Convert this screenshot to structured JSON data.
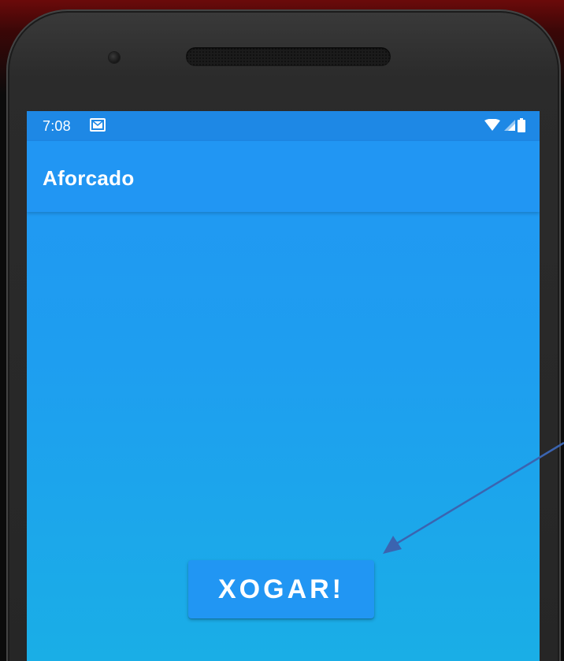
{
  "status_bar": {
    "time": "7:08",
    "icons": [
      "gmail-icon",
      "wifi-icon",
      "signal-icon",
      "battery-icon"
    ]
  },
  "app_bar": {
    "title": "Aforcado"
  },
  "main": {
    "play_button_label": "XOGAR!"
  },
  "colors": {
    "primary": "#2196f3",
    "primary_dark": "#1e88e5",
    "arrow": "#3b64b0",
    "frame": "#262626"
  },
  "annotation": {
    "type": "arrow",
    "icon": "pointer-arrow"
  }
}
